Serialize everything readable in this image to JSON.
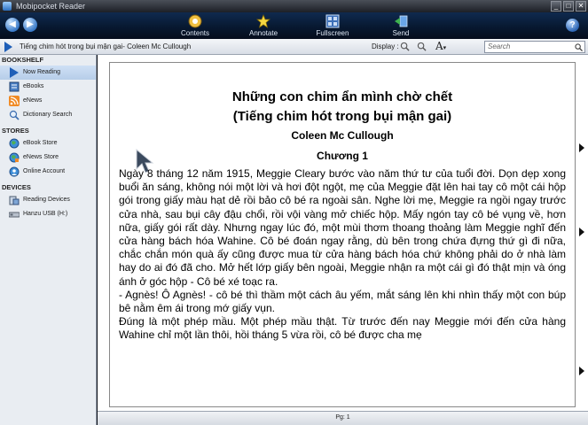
{
  "window": {
    "title": "Mobipocket Reader",
    "min": "_",
    "max": "□",
    "close": "✕"
  },
  "toolbar": {
    "tools": [
      {
        "label": "Contents",
        "icon": "contents-icon"
      },
      {
        "label": "Annotate",
        "icon": "annotate-star-icon"
      },
      {
        "label": "Fullscreen",
        "icon": "fullscreen-icon"
      },
      {
        "label": "Send",
        "icon": "send-icon"
      }
    ],
    "help_label": "?"
  },
  "infobar": {
    "book_title": "Tiếng chim hót trong bụi mận gai- Coleen Mc Cullough",
    "display_label": "Display :",
    "font_label": "A",
    "search_placeholder": "Search"
  },
  "sidebar": {
    "bookshelf_label": "BOOKSHELF",
    "bookshelf_items": [
      "Now Reading",
      "eBooks",
      "eNews",
      "Dictionary Search"
    ],
    "stores_label": "STORES",
    "stores_items": [
      "eBook Store",
      "eNews Store",
      "Online Account"
    ],
    "devices_label": "DEVICES",
    "devices_items": [
      "Reading Devices",
      "Hanzu USB (H:)"
    ]
  },
  "book": {
    "title_line1": "Những con chim ẩn mình chờ chết",
    "title_line2": "(Tiếng chim hót trong bụi mận gai)",
    "author": "Coleen Mc Cullough",
    "chapter": "Chương 1",
    "paragraphs": [
      "Ngày 8 tháng 12 năm 1915, Meggie Cleary bước vào năm thứ tư của tuổi đời. Dọn dẹp xong buổi ăn sáng, không nói một lời và hơi đột ngột, mẹ của Meggie đặt lên hai tay cô một cái hộp gói trong giấy màu hạt dẻ rồi bảo cô bé ra ngoài sân. Nghe lời mẹ, Meggie ra ngồi ngay trước cửa nhà, sau bụi cây đậu chổi, rồi vội vàng mở chiếc hộp. Mấy ngón tay cô bé vụng về, hơn nữa, giấy gói rất dày. Nhưng ngay lúc đó, một mùi thơm thoang thoảng làm Meggie nghĩ đến cửa hàng bách hóa Wahine. Cô bé đoán ngay rằng, dù bên trong chứa đựng thứ gì đi nữa, chắc chắn món quà ấy cũng được mua từ cửa hàng bách hóa chứ không phải do ở nhà làm hay do ai đó đã cho. Mở hết lớp giấy bên ngoài, Meggie nhận ra một cái gì đó thật mịn và óng ánh ở góc hộp - Cô bé xé toạc ra.",
      "- Agnès! Ô Agnès! - cô bé thì thầm một cách âu yếm, mắt sáng lên khi nhìn thấy một con búp bê nằm êm ái trong mớ giấy vụn.",
      "Đúng là một phép mầu. Một phép mầu thật. Từ trước đến nay Meggie mới đến cửa hàng Wahine chỉ một lần thôi, hồi tháng 5 vừa rồi, cô bé được cha mẹ"
    ]
  },
  "status": {
    "page": "Pg: 1"
  },
  "colors": {
    "toolbar_top": "#0f2a4f",
    "accent": "#1f5fb8",
    "sidebar_bg": "#e9edf2"
  }
}
